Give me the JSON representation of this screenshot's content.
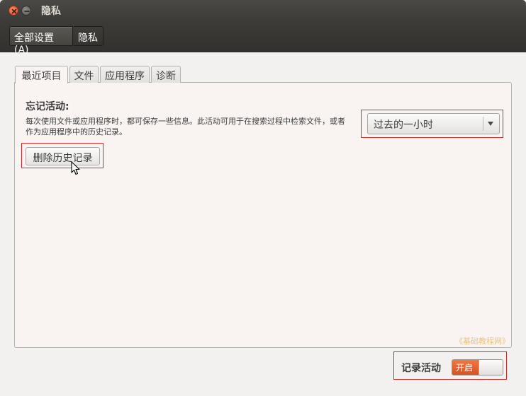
{
  "window": {
    "title": "隐私"
  },
  "toolbar": {
    "all_settings": "全部设置(A)",
    "privacy": "隐私"
  },
  "tabs": [
    {
      "label": "最近项目",
      "active": true
    },
    {
      "label": "文件",
      "active": false
    },
    {
      "label": "应用程序",
      "active": false
    },
    {
      "label": "诊断",
      "active": false
    }
  ],
  "recent": {
    "heading": "忘记活动:",
    "description": "每次使用文件或应用程序时，都可保存一些信息。此活动可用于在搜索过程中检索文件，或者作为应用程序中的历史记录。",
    "delete_button": "删除历史记录",
    "forget_period": "过去的一小时"
  },
  "watermark": "《基础教程网》",
  "record_activity": {
    "label": "记录活动",
    "state": "开启"
  },
  "colors": {
    "accent": "#dd5b25",
    "highlight_box": "#d42b2b"
  }
}
